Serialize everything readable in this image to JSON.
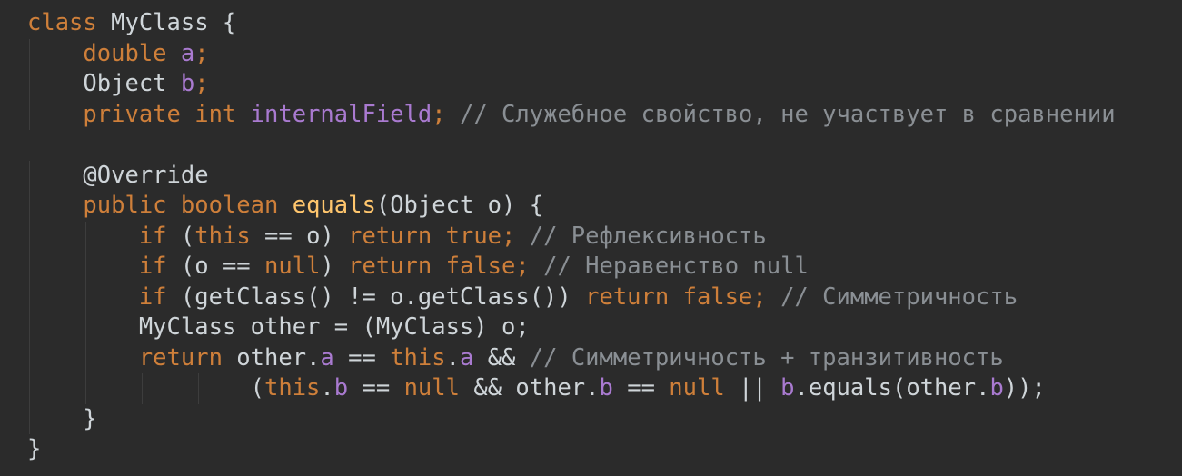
{
  "colors": {
    "background": "#2b2b2b",
    "keyword": "#ce7f3a",
    "plain": "#cfd5d9",
    "field": "#a97ad0",
    "comment": "#8a8f94",
    "method": "#ffc66d",
    "annotation": "#bbb529"
  },
  "code": {
    "language": "java",
    "lines": [
      {
        "indent": 0,
        "tokens": [
          {
            "t": "keyword",
            "v": "class"
          },
          {
            "t": "plain",
            "v": " MyClass {"
          }
        ]
      },
      {
        "indent": 1,
        "tokens": [
          {
            "t": "keyword",
            "v": "double"
          },
          {
            "t": "plain",
            "v": " "
          },
          {
            "t": "field",
            "v": "a"
          },
          {
            "t": "keyword",
            "v": ";"
          }
        ]
      },
      {
        "indent": 1,
        "tokens": [
          {
            "t": "plain",
            "v": "Object "
          },
          {
            "t": "field",
            "v": "b"
          },
          {
            "t": "keyword",
            "v": ";"
          }
        ]
      },
      {
        "indent": 1,
        "tokens": [
          {
            "t": "keyword",
            "v": "private int"
          },
          {
            "t": "plain",
            "v": " "
          },
          {
            "t": "field",
            "v": "internalField"
          },
          {
            "t": "keyword",
            "v": ";"
          },
          {
            "t": "plain",
            "v": " "
          },
          {
            "t": "comment",
            "v": "// Служебное свойство, не участвует в сравнении"
          }
        ]
      },
      {
        "indent": 0,
        "tokens": [
          {
            "t": "plain",
            "v": ""
          }
        ]
      },
      {
        "indent": 1,
        "tokens": [
          {
            "t": "annotation",
            "v": "@Override"
          }
        ]
      },
      {
        "indent": 1,
        "tokens": [
          {
            "t": "keyword",
            "v": "public boolean"
          },
          {
            "t": "plain",
            "v": " "
          },
          {
            "t": "method",
            "v": "equals"
          },
          {
            "t": "plain",
            "v": "(Object o) {"
          }
        ]
      },
      {
        "indent": 2,
        "tokens": [
          {
            "t": "keyword",
            "v": "if"
          },
          {
            "t": "plain",
            "v": " ("
          },
          {
            "t": "keyword",
            "v": "this"
          },
          {
            "t": "plain",
            "v": " == o) "
          },
          {
            "t": "keyword",
            "v": "return true;"
          },
          {
            "t": "plain",
            "v": " "
          },
          {
            "t": "comment",
            "v": "// Рефлексивность"
          }
        ]
      },
      {
        "indent": 2,
        "tokens": [
          {
            "t": "keyword",
            "v": "if"
          },
          {
            "t": "plain",
            "v": " (o == "
          },
          {
            "t": "keyword",
            "v": "null"
          },
          {
            "t": "plain",
            "v": ") "
          },
          {
            "t": "keyword",
            "v": "return false;"
          },
          {
            "t": "plain",
            "v": " "
          },
          {
            "t": "comment",
            "v": "// Неравенство null"
          }
        ]
      },
      {
        "indent": 2,
        "tokens": [
          {
            "t": "keyword",
            "v": "if"
          },
          {
            "t": "plain",
            "v": " (getClass() != o.getClass()) "
          },
          {
            "t": "keyword",
            "v": "return false;"
          },
          {
            "t": "plain",
            "v": " "
          },
          {
            "t": "comment",
            "v": "// Симметричность"
          }
        ]
      },
      {
        "indent": 2,
        "tokens": [
          {
            "t": "plain",
            "v": "MyClass other = (MyClass) o;"
          }
        ]
      },
      {
        "indent": 2,
        "tokens": [
          {
            "t": "keyword",
            "v": "return"
          },
          {
            "t": "plain",
            "v": " other."
          },
          {
            "t": "field",
            "v": "a"
          },
          {
            "t": "plain",
            "v": " == "
          },
          {
            "t": "keyword",
            "v": "this"
          },
          {
            "t": "plain",
            "v": "."
          },
          {
            "t": "field",
            "v": "a"
          },
          {
            "t": "plain",
            "v": " && "
          },
          {
            "t": "comment",
            "v": "// Симметричность + транзитивность"
          }
        ]
      },
      {
        "indent": 4,
        "tokens": [
          {
            "t": "plain",
            "v": "("
          },
          {
            "t": "keyword",
            "v": "this"
          },
          {
            "t": "plain",
            "v": "."
          },
          {
            "t": "field",
            "v": "b"
          },
          {
            "t": "plain",
            "v": " == "
          },
          {
            "t": "keyword",
            "v": "null"
          },
          {
            "t": "plain",
            "v": " && other."
          },
          {
            "t": "field",
            "v": "b"
          },
          {
            "t": "plain",
            "v": " == "
          },
          {
            "t": "keyword",
            "v": "null"
          },
          {
            "t": "plain",
            "v": " || "
          },
          {
            "t": "field",
            "v": "b"
          },
          {
            "t": "plain",
            "v": ".equals(other."
          },
          {
            "t": "field",
            "v": "b"
          },
          {
            "t": "plain",
            "v": "));"
          }
        ]
      },
      {
        "indent": 1,
        "tokens": [
          {
            "t": "plain",
            "v": "}"
          }
        ]
      },
      {
        "indent": 0,
        "tokens": [
          {
            "t": "plain",
            "v": "}"
          }
        ]
      }
    ]
  }
}
